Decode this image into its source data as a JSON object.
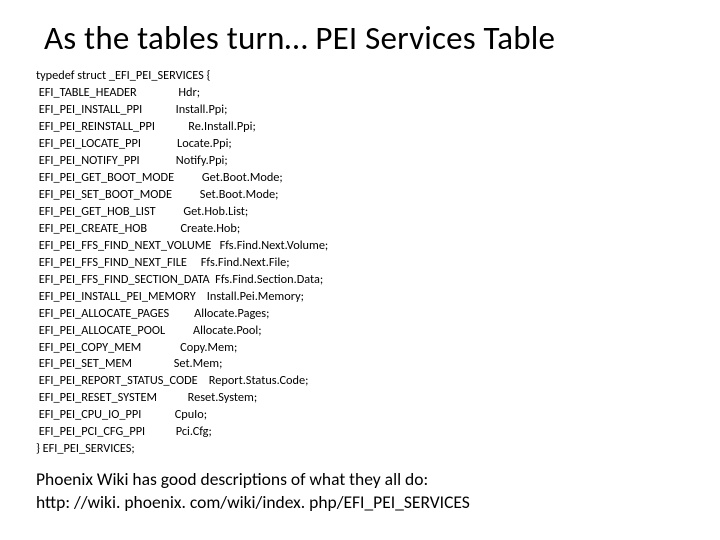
{
  "title": "As the tables turn… PEI Services Table",
  "code": {
    "lines": [
      "typedef struct _EFI_PEI_SERVICES {",
      " EFI_TABLE_HEADER               Hdr;",
      " EFI_PEI_INSTALL_PPI            Install.Ppi;",
      " EFI_PEI_REINSTALL_PPI            Re.Install.Ppi;",
      " EFI_PEI_LOCATE_PPI             Locate.Ppi;",
      " EFI_PEI_NOTIFY_PPI             Notify.Ppi;",
      " EFI_PEI_GET_BOOT_MODE          Get.Boot.Mode;",
      " EFI_PEI_SET_BOOT_MODE          Set.Boot.Mode;",
      " EFI_PEI_GET_HOB_LIST          Get.Hob.List;",
      " EFI_PEI_CREATE_HOB            Create.Hob;",
      " EFI_PEI_FFS_FIND_NEXT_VOLUME   Ffs.Find.Next.Volume;",
      " EFI_PEI_FFS_FIND_NEXT_FILE     Ffs.Find.Next.File;",
      " EFI_PEI_FFS_FIND_SECTION_DATA  Ffs.Find.Section.Data;",
      " EFI_PEI_INSTALL_PEI_MEMORY    Install.Pei.Memory;",
      " EFI_PEI_ALLOCATE_PAGES         Allocate.Pages;",
      " EFI_PEI_ALLOCATE_POOL          Allocate.Pool;",
      " EFI_PEI_COPY_MEM              Copy.Mem;",
      " EFI_PEI_SET_MEM               Set.Mem;",
      " EFI_PEI_REPORT_STATUS_CODE    Report.Status.Code;",
      " EFI_PEI_RESET_SYSTEM           Reset.System;",
      " EFI_PEI_CPU_IO_PPI            CpuIo;",
      " EFI_PEI_PCI_CFG_PPI           Pci.Cfg;",
      "} EFI_PEI_SERVICES;"
    ]
  },
  "footnote_line1": "Phoenix Wiki has good descriptions of what they all do:",
  "footnote_line2": "http: //wiki. phoenix. com/wiki/index. php/EFI_PEI_SERVICES"
}
